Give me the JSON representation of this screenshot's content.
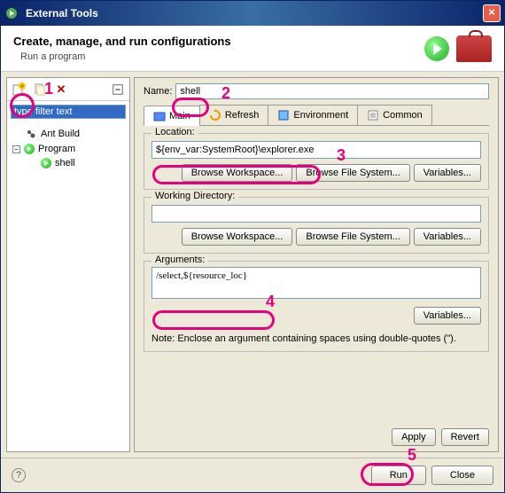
{
  "titlebar": {
    "title": "External Tools"
  },
  "header": {
    "title": "Create, manage, and run configurations",
    "subtitle": "Run a program"
  },
  "sidebar": {
    "filter_text": "type filter text",
    "items": [
      {
        "label": "Ant Build"
      },
      {
        "label": "Program",
        "children": [
          {
            "label": "shell"
          }
        ]
      }
    ]
  },
  "main": {
    "name_label": "Name:",
    "name_value": "shell",
    "tabs": [
      {
        "label": "Main"
      },
      {
        "label": "Refresh"
      },
      {
        "label": "Environment"
      },
      {
        "label": "Common"
      }
    ],
    "location": {
      "label": "Location:",
      "value": "${env_var:SystemRoot}\\explorer.exe"
    },
    "working_dir": {
      "label": "Working Directory:",
      "value": ""
    },
    "arguments": {
      "label": "Arguments:",
      "value": "/select,${resource_loc}"
    },
    "buttons": {
      "browse_workspace": "Browse Workspace...",
      "browse_filesystem": "Browse File System...",
      "variables": "Variables..."
    },
    "note": "Note: Enclose an argument containing spaces using double-quotes (\").",
    "apply": "Apply",
    "revert": "Revert"
  },
  "footer": {
    "run": "Run",
    "close": "Close"
  },
  "annotations": {
    "a1": "1",
    "a2": "2",
    "a3": "3",
    "a4": "4",
    "a5": "5"
  }
}
